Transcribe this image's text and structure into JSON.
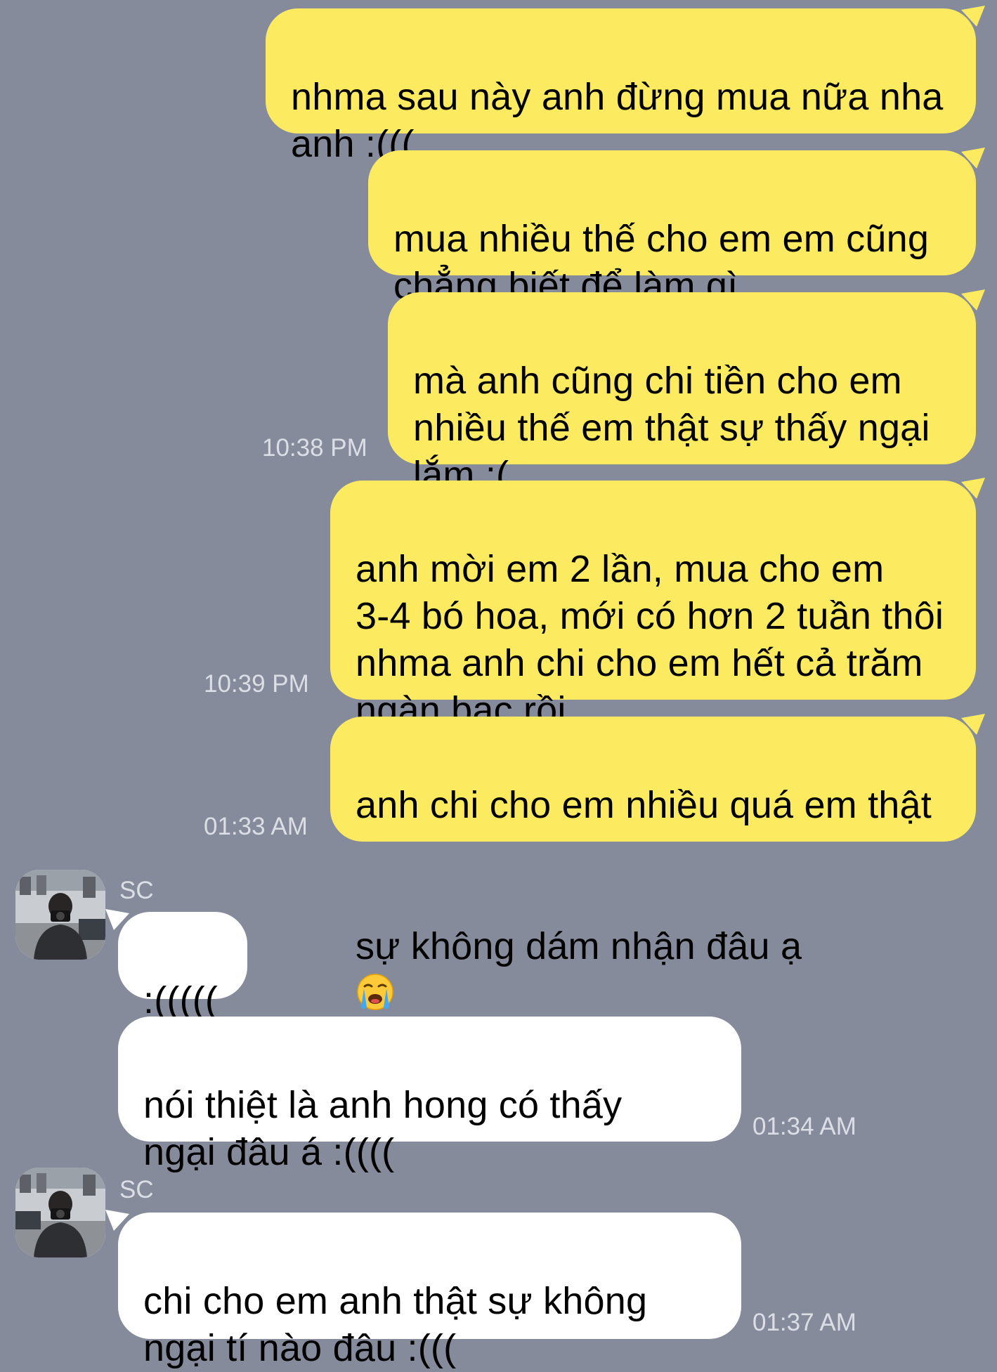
{
  "colors": {
    "background": "#868b9b",
    "outgoing_bubble": "#fcea61",
    "incoming_bubble": "#ffffff",
    "timestamp": "#dcdee6"
  },
  "messages": [
    {
      "direction": "out",
      "text": "nhma sau này anh đừng mua nữa nha\nanh :(((",
      "time": ""
    },
    {
      "direction": "out",
      "text": "mua nhiều thế cho em em cũng\nchẳng biết để làm gì",
      "time": ""
    },
    {
      "direction": "out",
      "text": "mà anh cũng chi tiền cho em\nnhiều thế em thật sự thấy ngại\nlắm :(",
      "time": "10:38 PM"
    },
    {
      "direction": "out",
      "text": "anh mời em 2 lần, mua cho em\n3-4 bó hoa, mới có hơn 2 tuần thôi\nnhma anh chi cho em hết cả trăm\nngàn bạc rồi",
      "time": "10:39 PM"
    },
    {
      "direction": "out",
      "text_line1": "anh chi cho em nhiều quá em thật",
      "text_line2": "sự không dám nhận đâu ạ",
      "emoji": "loudly-crying-face",
      "time": "01:33 AM"
    },
    {
      "direction": "in",
      "sender": "SC",
      "text": ":(((((",
      "time": ""
    },
    {
      "direction": "in",
      "text": "nói thiệt là anh hong có thấy\nngại đâu á :((((",
      "time": "01:34 AM"
    },
    {
      "direction": "in",
      "sender": "SC",
      "text": "chi cho em anh thật sự không\nngại tí nào đâu :(((",
      "time": "01:37 AM"
    }
  ]
}
